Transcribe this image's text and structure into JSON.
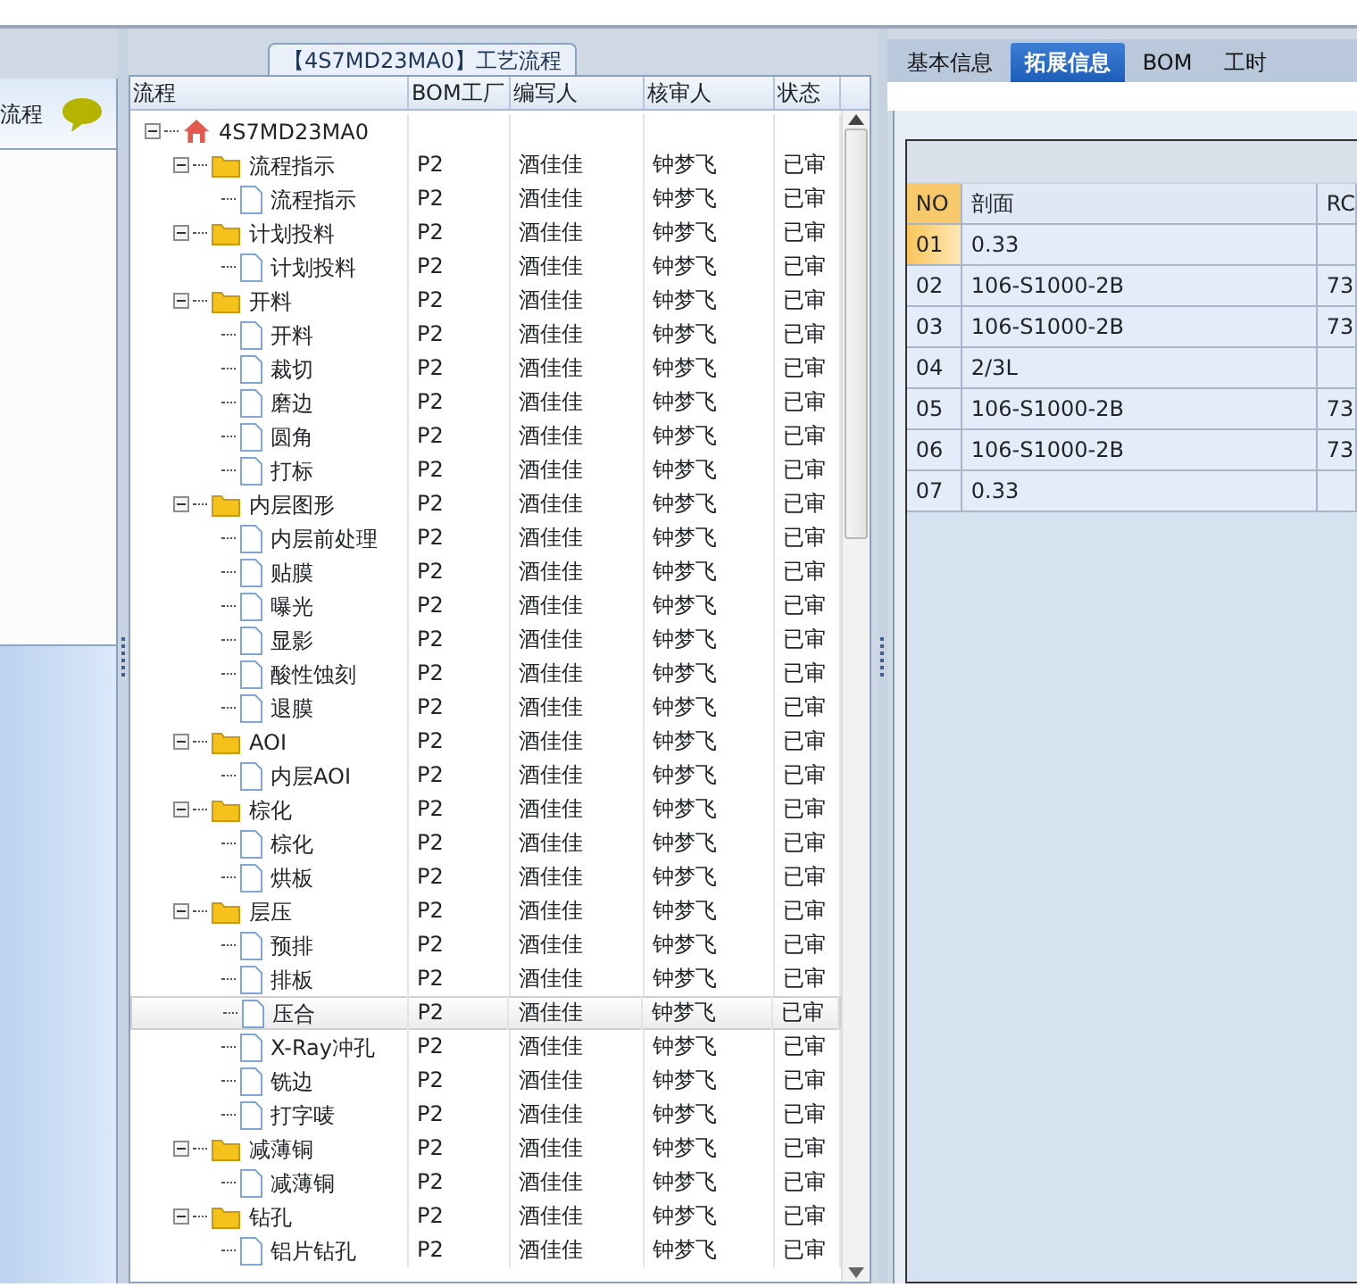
{
  "left_panel": {
    "title": "流程"
  },
  "process_panel": {
    "title": "【4S7MD23MA0】工艺流程",
    "columns": [
      "流程",
      "BOM工厂",
      "编写人",
      "核审人",
      "状态"
    ],
    "tree": [
      {
        "name": "4S7MD23MA0",
        "kind": "root",
        "expanded": true,
        "selected": false,
        "children": [
          {
            "name": "流程指示",
            "kind": "folder",
            "expanded": true,
            "selected": false,
            "bom": "P2",
            "writer": "酒佳佳",
            "reviewer": "钟梦飞",
            "status": "已审",
            "children": [
              {
                "name": "流程指示",
                "kind": "file",
                "selected": false,
                "bom": "P2",
                "writer": "酒佳佳",
                "reviewer": "钟梦飞",
                "status": "已审"
              }
            ]
          },
          {
            "name": "计划投料",
            "kind": "folder",
            "expanded": true,
            "selected": false,
            "bom": "P2",
            "writer": "酒佳佳",
            "reviewer": "钟梦飞",
            "status": "已审",
            "children": [
              {
                "name": "计划投料",
                "kind": "file",
                "selected": false,
                "bom": "P2",
                "writer": "酒佳佳",
                "reviewer": "钟梦飞",
                "status": "已审"
              }
            ]
          },
          {
            "name": "开料",
            "kind": "folder",
            "expanded": true,
            "selected": false,
            "bom": "P2",
            "writer": "酒佳佳",
            "reviewer": "钟梦飞",
            "status": "已审",
            "children": [
              {
                "name": "开料",
                "kind": "file",
                "selected": false,
                "bom": "P2",
                "writer": "酒佳佳",
                "reviewer": "钟梦飞",
                "status": "已审"
              },
              {
                "name": "裁切",
                "kind": "file",
                "selected": false,
                "bom": "P2",
                "writer": "酒佳佳",
                "reviewer": "钟梦飞",
                "status": "已审"
              },
              {
                "name": "磨边",
                "kind": "file",
                "selected": false,
                "bom": "P2",
                "writer": "酒佳佳",
                "reviewer": "钟梦飞",
                "status": "已审"
              },
              {
                "name": "圆角",
                "kind": "file",
                "selected": false,
                "bom": "P2",
                "writer": "酒佳佳",
                "reviewer": "钟梦飞",
                "status": "已审"
              },
              {
                "name": "打标",
                "kind": "file",
                "selected": false,
                "bom": "P2",
                "writer": "酒佳佳",
                "reviewer": "钟梦飞",
                "status": "已审"
              }
            ]
          },
          {
            "name": "内层图形",
            "kind": "folder",
            "expanded": true,
            "selected": false,
            "bom": "P2",
            "writer": "酒佳佳",
            "reviewer": "钟梦飞",
            "status": "已审",
            "children": [
              {
                "name": "内层前处理",
                "kind": "file",
                "selected": false,
                "bom": "P2",
                "writer": "酒佳佳",
                "reviewer": "钟梦飞",
                "status": "已审"
              },
              {
                "name": "贴膜",
                "kind": "file",
                "selected": false,
                "bom": "P2",
                "writer": "酒佳佳",
                "reviewer": "钟梦飞",
                "status": "已审"
              },
              {
                "name": "曝光",
                "kind": "file",
                "selected": false,
                "bom": "P2",
                "writer": "酒佳佳",
                "reviewer": "钟梦飞",
                "status": "已审"
              },
              {
                "name": "显影",
                "kind": "file",
                "selected": false,
                "bom": "P2",
                "writer": "酒佳佳",
                "reviewer": "钟梦飞",
                "status": "已审"
              },
              {
                "name": "酸性蚀刻",
                "kind": "file",
                "selected": false,
                "bom": "P2",
                "writer": "酒佳佳",
                "reviewer": "钟梦飞",
                "status": "已审"
              },
              {
                "name": "退膜",
                "kind": "file",
                "selected": false,
                "bom": "P2",
                "writer": "酒佳佳",
                "reviewer": "钟梦飞",
                "status": "已审"
              }
            ]
          },
          {
            "name": "AOI",
            "kind": "folder",
            "expanded": true,
            "selected": false,
            "bom": "P2",
            "writer": "酒佳佳",
            "reviewer": "钟梦飞",
            "status": "已审",
            "children": [
              {
                "name": "内层AOI",
                "kind": "file",
                "selected": false,
                "bom": "P2",
                "writer": "酒佳佳",
                "reviewer": "钟梦飞",
                "status": "已审"
              }
            ]
          },
          {
            "name": "棕化",
            "kind": "folder",
            "expanded": true,
            "selected": false,
            "bom": "P2",
            "writer": "酒佳佳",
            "reviewer": "钟梦飞",
            "status": "已审",
            "children": [
              {
                "name": "棕化",
                "kind": "file",
                "selected": false,
                "bom": "P2",
                "writer": "酒佳佳",
                "reviewer": "钟梦飞",
                "status": "已审"
              },
              {
                "name": "烘板",
                "kind": "file",
                "selected": false,
                "bom": "P2",
                "writer": "酒佳佳",
                "reviewer": "钟梦飞",
                "status": "已审"
              }
            ]
          },
          {
            "name": "层压",
            "kind": "folder",
            "expanded": true,
            "selected": false,
            "bom": "P2",
            "writer": "酒佳佳",
            "reviewer": "钟梦飞",
            "status": "已审",
            "children": [
              {
                "name": "预排",
                "kind": "file",
                "selected": false,
                "bom": "P2",
                "writer": "酒佳佳",
                "reviewer": "钟梦飞",
                "status": "已审"
              },
              {
                "name": "排板",
                "kind": "file",
                "selected": false,
                "bom": "P2",
                "writer": "酒佳佳",
                "reviewer": "钟梦飞",
                "status": "已审"
              },
              {
                "name": "压合",
                "kind": "file",
                "selected": true,
                "bom": "P2",
                "writer": "酒佳佳",
                "reviewer": "钟梦飞",
                "status": "已审"
              },
              {
                "name": "X-Ray冲孔",
                "kind": "file",
                "selected": false,
                "bom": "P2",
                "writer": "酒佳佳",
                "reviewer": "钟梦飞",
                "status": "已审"
              },
              {
                "name": "铣边",
                "kind": "file",
                "selected": false,
                "bom": "P2",
                "writer": "酒佳佳",
                "reviewer": "钟梦飞",
                "status": "已审"
              },
              {
                "name": "打字唛",
                "kind": "file",
                "selected": false,
                "bom": "P2",
                "writer": "酒佳佳",
                "reviewer": "钟梦飞",
                "status": "已审"
              }
            ]
          },
          {
            "name": "减薄铜",
            "kind": "folder",
            "expanded": true,
            "selected": false,
            "bom": "P2",
            "writer": "酒佳佳",
            "reviewer": "钟梦飞",
            "status": "已审",
            "children": [
              {
                "name": "减薄铜",
                "kind": "file",
                "selected": false,
                "bom": "P2",
                "writer": "酒佳佳",
                "reviewer": "钟梦飞",
                "status": "已审"
              }
            ]
          },
          {
            "name": "钻孔",
            "kind": "folder",
            "expanded": true,
            "selected": false,
            "bom": "P2",
            "writer": "酒佳佳",
            "reviewer": "钟梦飞",
            "status": "已审",
            "children": [
              {
                "name": "铝片钻孔",
                "kind": "file",
                "selected": false,
                "bom": "P2",
                "writer": "酒佳佳",
                "reviewer": "钟梦飞",
                "status": "已审"
              }
            ]
          }
        ]
      }
    ]
  },
  "detail_panel": {
    "tabs": [
      {
        "label": "基本信息",
        "selected": false
      },
      {
        "label": "拓展信息",
        "selected": true
      },
      {
        "label": "BOM",
        "selected": false
      },
      {
        "label": "工时",
        "selected": false
      }
    ],
    "columns": [
      "NO",
      "剖面",
      "RC"
    ],
    "rows": [
      {
        "no": "01",
        "section": "0.33",
        "rc": "",
        "selected": true
      },
      {
        "no": "02",
        "section": "106-S1000-2B",
        "rc": "73",
        "selected": false
      },
      {
        "no": "03",
        "section": "106-S1000-2B",
        "rc": "73",
        "selected": false
      },
      {
        "no": "04",
        "section": "2/3L",
        "rc": "",
        "selected": false
      },
      {
        "no": "05",
        "section": "106-S1000-2B",
        "rc": "73",
        "selected": false
      },
      {
        "no": "06",
        "section": "106-S1000-2B",
        "rc": "73",
        "selected": false
      },
      {
        "no": "07",
        "section": "0.33",
        "rc": "",
        "selected": false
      }
    ]
  }
}
